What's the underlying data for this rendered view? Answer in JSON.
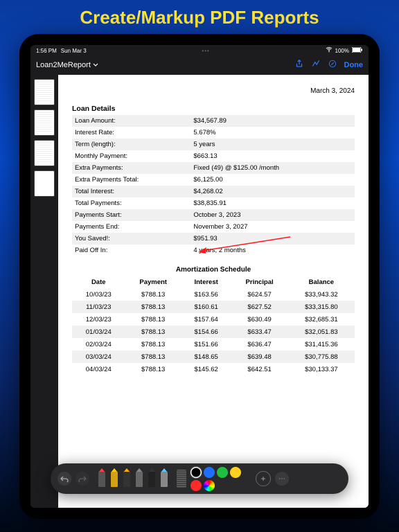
{
  "promo_title": "Create/Markup PDF Reports",
  "status": {
    "time": "1:56 PM",
    "date": "Sun Mar 3",
    "battery": "100%"
  },
  "nav": {
    "title": "Loan2MeReport",
    "done": "Done"
  },
  "document": {
    "date": "March 3, 2024",
    "loan_details_header": "Loan Details",
    "rows": [
      {
        "label": "Loan Amount:",
        "value": "$34,567.89"
      },
      {
        "label": "Interest Rate:",
        "value": "5.678%"
      },
      {
        "label": "Term (length):",
        "value": "5 years"
      },
      {
        "label": "Monthly Payment:",
        "value": "$663.13"
      },
      {
        "label": "Extra Payments:",
        "value": "Fixed (49) @ $125.00 /month"
      },
      {
        "label": "Extra Payments Total:",
        "value": "$6,125.00"
      },
      {
        "label": "Total Interest:",
        "value": "$4,268.02"
      },
      {
        "label": "Total Payments:",
        "value": "$38,835.91"
      },
      {
        "label": "Payments Start:",
        "value": "October 3, 2023"
      },
      {
        "label": "Payments End:",
        "value": "November 3, 2027"
      },
      {
        "label": "You Saved!:",
        "value": "$951.93"
      },
      {
        "label": "Paid Off In:",
        "value": "4 years, 2 months"
      }
    ],
    "schedule_header": "Amortization Schedule",
    "schedule_cols": [
      "Date",
      "Payment",
      "Interest",
      "Principal",
      "Balance"
    ],
    "schedule_rows": [
      [
        "10/03/23",
        "$788.13",
        "$163.56",
        "$624.57",
        "$33,943.32"
      ],
      [
        "11/03/23",
        "$788.13",
        "$160.61",
        "$627.52",
        "$33,315.80"
      ],
      [
        "12/03/23",
        "$788.13",
        "$157.64",
        "$630.49",
        "$32,685.31"
      ],
      [
        "01/03/24",
        "$788.13",
        "$154.66",
        "$633.47",
        "$32,051.83"
      ],
      [
        "02/03/24",
        "$788.13",
        "$151.66",
        "$636.47",
        "$31,415.36"
      ],
      [
        "03/03/24",
        "$788.13",
        "$148.65",
        "$639.48",
        "$30,775.88"
      ],
      [
        "04/03/24",
        "$788.13",
        "$145.62",
        "$642.51",
        "$30,133.37"
      ]
    ]
  },
  "toolbar": {
    "colors": [
      "#000000",
      "#1e6fff",
      "#1fbf3f",
      "#ffd21f",
      "#ff2a2a"
    ],
    "pens": [
      {
        "tip": "#ff3b3b",
        "body": "#555"
      },
      {
        "tip": "#ffcc00",
        "body": "#d4a016"
      },
      {
        "tip": "#ffaa00",
        "body": "#333"
      },
      {
        "tip": "#888",
        "body": "#666"
      },
      {
        "tip": "#333",
        "body": "#222"
      },
      {
        "tip": "#5ac8ff",
        "body": "#888"
      }
    ]
  }
}
